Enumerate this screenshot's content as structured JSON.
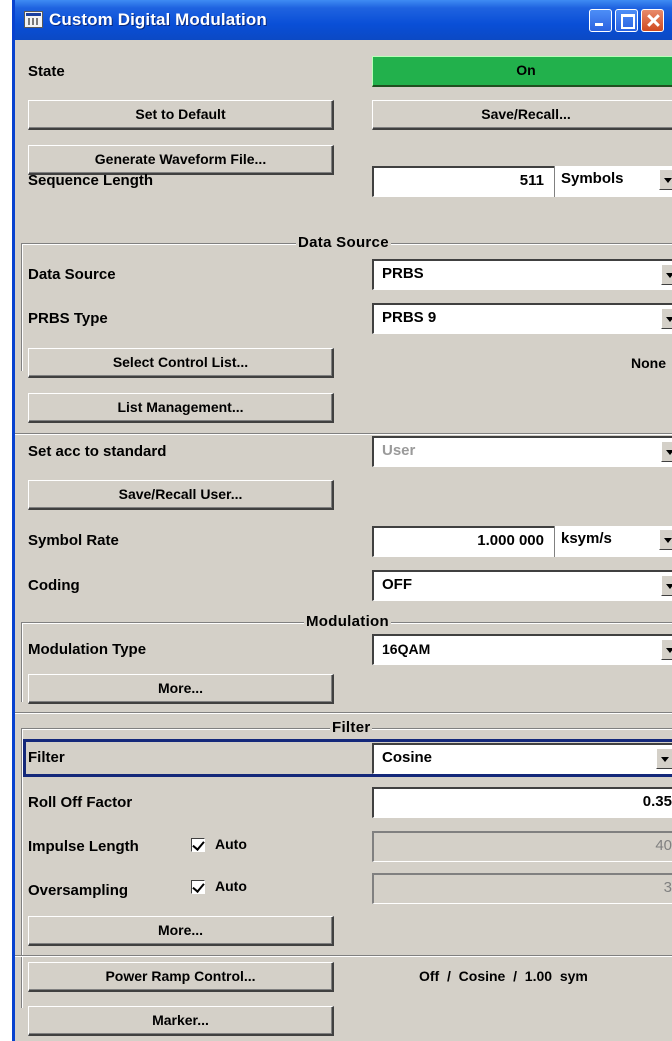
{
  "window": {
    "title": "Custom Digital Modulation"
  },
  "state": {
    "label": "State",
    "value": "On"
  },
  "buttons": {
    "set_default": "Set to Default",
    "save_recall": "Save/Recall...",
    "generate_waveform": "Generate Waveform File...",
    "select_control_list": "Select Control List...",
    "list_management": "List Management...",
    "save_recall_user": "Save/Recall User...",
    "modulation_more": "More...",
    "filter_more": "More...",
    "power_ramp": "Power Ramp Control...",
    "marker": "Marker..."
  },
  "sequence_length": {
    "label": "Sequence Length",
    "value": "511",
    "unit": "Symbols"
  },
  "data_source_section": {
    "title": "Data Source",
    "data_source": {
      "label": "Data Source",
      "value": "PRBS"
    },
    "prbs_type": {
      "label": "PRBS Type",
      "value": "PRBS 9"
    },
    "control_list_value": "None"
  },
  "standard": {
    "label": "Set acc to standard",
    "value": "User"
  },
  "symbol_rate": {
    "label": "Symbol Rate",
    "value": "1.000 000",
    "unit": "ksym/s"
  },
  "coding": {
    "label": "Coding",
    "value": "OFF"
  },
  "modulation_section": {
    "title": "Modulation",
    "modulation_type": {
      "label": "Modulation Type",
      "value": "16QAM"
    }
  },
  "filter_section": {
    "title": "Filter",
    "filter": {
      "label": "Filter",
      "value": "Cosine"
    },
    "roll_off": {
      "label": "Roll Off Factor",
      "value": "0.35"
    },
    "impulse_length": {
      "label": "Impulse Length",
      "auto_label": "Auto",
      "value": "40"
    },
    "oversampling": {
      "label": "Oversampling",
      "auto_label": "Auto",
      "value": "3"
    }
  },
  "power_ramp_status": "Off  /  Cosine  /  1.00  sym"
}
